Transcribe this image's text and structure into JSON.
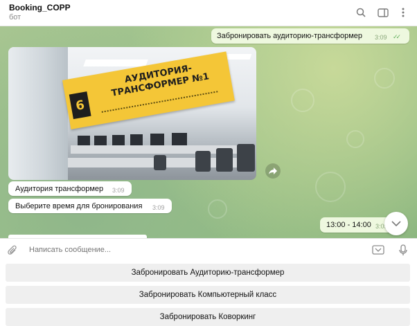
{
  "header": {
    "title": "Booking_COPP",
    "subtitle": "бот"
  },
  "messages": {
    "outgoing_1": {
      "text": "Забронировать аудиторию-трансформер",
      "time": "3:09"
    },
    "photo": {
      "sign_number": "6",
      "sign_text": "АУДИТОРИЯ-ТРАНСФОРМЕР №1"
    },
    "incoming_1": {
      "text": "Аудитория трансформер",
      "time": "3:09"
    },
    "incoming_2": {
      "text": "Выберите время для бронирования",
      "time": "3:09"
    },
    "outgoing_2": {
      "text": "13:00 - 14:00",
      "time": "3:09"
    }
  },
  "composer": {
    "placeholder": "Написать сообщение..."
  },
  "keyboard": {
    "buttons": [
      "Забронировать Аудиторию-трансформер",
      "Забронировать Компьютерный класс",
      "Забронировать Коворкинг"
    ]
  },
  "icons": {
    "search": "search-icon",
    "sidebar": "sidebar-toggle-icon",
    "menu": "more-vertical-icon",
    "share": "share-arrow-icon",
    "scroll": "chevron-down-icon",
    "attach": "paperclip-icon",
    "bot_keyboard": "bot-keyboard-icon",
    "mic": "microphone-icon"
  },
  "colors": {
    "outgoing_bubble": "#eef8df",
    "incoming_bubble": "#ffffff",
    "sign": "#f4c637",
    "check": "#5fae5a"
  }
}
